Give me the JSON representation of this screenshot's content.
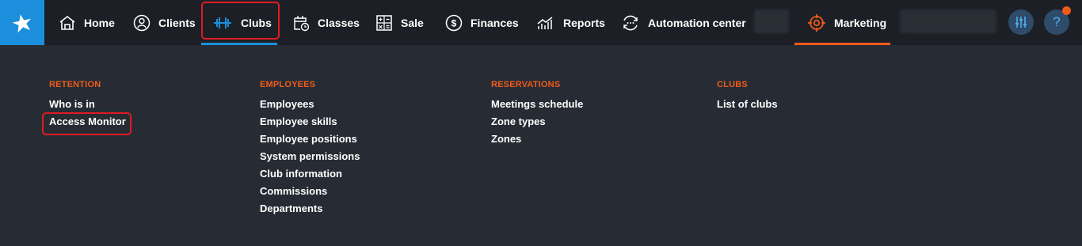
{
  "nav": {
    "items": [
      {
        "label": "Home",
        "icon": "home-icon"
      },
      {
        "label": "Clients",
        "icon": "clients-icon"
      },
      {
        "label": "Clubs",
        "icon": "dumbbell-icon"
      },
      {
        "label": "Classes",
        "icon": "calendar-clock-icon"
      },
      {
        "label": "Sale",
        "icon": "calculator-icon"
      },
      {
        "label": "Finances",
        "icon": "dollar-circle-icon"
      },
      {
        "label": "Reports",
        "icon": "chart-icon"
      },
      {
        "label": "Automation center",
        "icon": "automation-icon"
      },
      {
        "label": "Marketing",
        "icon": "target-icon"
      }
    ],
    "help_label": "?"
  },
  "menu": {
    "retention": {
      "heading": "RETENTION",
      "links": [
        "Who is in",
        "Access Monitor"
      ]
    },
    "employees": {
      "heading": "EMPLOYEES",
      "links": [
        "Employees",
        "Employee skills",
        "Employee positions",
        "System permissions",
        "Club information",
        "Commissions",
        "Departments"
      ]
    },
    "reservations": {
      "heading": "RESERVATIONS",
      "links": [
        "Meetings schedule",
        "Zone types",
        "Zones"
      ]
    },
    "clubs": {
      "heading": "CLUBS",
      "links": [
        "List of clubs"
      ]
    }
  },
  "colors": {
    "accent_blue": "#1b8fdc",
    "accent_orange": "#f05a1a",
    "highlight_red": "#e11b22",
    "topbar_bg": "#1c2026",
    "panel_bg": "#272c34"
  }
}
